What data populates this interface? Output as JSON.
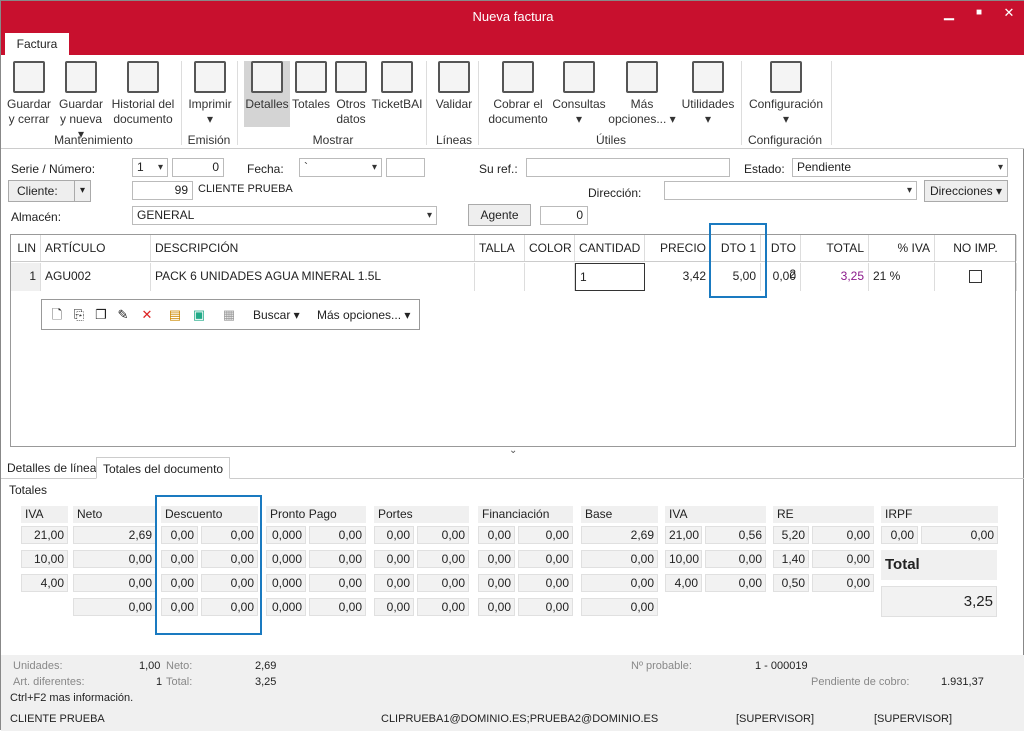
{
  "window": {
    "title": "Nueva factura",
    "minimize": "▁",
    "maximize": "■",
    "close": "✕"
  },
  "ribbon": {
    "tab": "Factura",
    "buttons": [
      {
        "id": "guardar-cerrar",
        "label": "Guardar\ny cerrar",
        "icon": "save-close-icon"
      },
      {
        "id": "guardar-nueva",
        "label": "Guardar\ny nueva ▾",
        "icon": "save-new-icon"
      },
      {
        "id": "historial",
        "label": "Historial del\ndocumento",
        "icon": "history-icon"
      },
      {
        "id": "imprimir",
        "label": "Imprimir\n▾",
        "icon": "printer-icon"
      },
      {
        "id": "detalles",
        "label": "Detalles",
        "icon": "details-icon",
        "selected": true
      },
      {
        "id": "totales",
        "label": "Totales",
        "icon": "totals-icon"
      },
      {
        "id": "otros-datos",
        "label": "Otros\ndatos",
        "icon": "other-data-icon"
      },
      {
        "id": "ticketbai",
        "label": "TicketBAI",
        "icon": "qr-icon"
      },
      {
        "id": "validar",
        "label": "Validar",
        "icon": "validate-icon"
      },
      {
        "id": "cobrar",
        "label": "Cobrar el\ndocumento",
        "icon": "money-icon"
      },
      {
        "id": "consultas",
        "label": "Consultas\n▾",
        "icon": "reports-icon"
      },
      {
        "id": "mas-opciones",
        "label": "Más\nopciones... ▾",
        "icon": "phone-icon"
      },
      {
        "id": "utilidades",
        "label": "Utilidades\n▾",
        "icon": "calculator-icon"
      },
      {
        "id": "configuracion",
        "label": "Configuración\n▾",
        "icon": "gear-icon"
      }
    ],
    "groups": [
      "Mantenimiento",
      "Emisión",
      "Mostrar",
      "Líneas",
      "Útiles",
      "Configuración"
    ]
  },
  "header": {
    "serie_label": "Serie / Número:",
    "serie": "1",
    "numero": "0",
    "fecha_label": "Fecha:",
    "fecha": "`",
    "suref_label": "Su ref.:",
    "suref": "",
    "estado_label": "Estado:",
    "estado": "Pendiente",
    "cliente_btn": "Cliente:",
    "cliente_code": "99",
    "cliente_name": "CLIENTE PRUEBA",
    "direccion_label": "Dirección:",
    "direccion": "",
    "direcciones_btn": "Direcciones ▾",
    "almacen_label": "Almacén:",
    "almacen": "GENERAL",
    "agente_btn": "Agente",
    "agente": "0"
  },
  "lines": {
    "columns": [
      "LIN",
      "ARTÍCULO",
      "DESCRIPCIÓN",
      "TALLA",
      "COLOR",
      "CANTIDAD",
      "PRECIO",
      "DTO 1",
      "DTO 2",
      "TOTAL",
      "% IVA",
      "NO IMP."
    ],
    "rows": [
      {
        "lin": "1",
        "articulo": "AGU002",
        "descripcion": "PACK 6 UNIDADES AGUA MINERAL 1.5L",
        "talla": "",
        "color": "",
        "cantidad": "1",
        "precio": "3,42",
        "dto1": "5,00",
        "dto2": "0,00",
        "total": "3,25",
        "iva": "21 %",
        "no_imp": false
      }
    ],
    "toolbar": {
      "buscar": "Buscar ▾",
      "mas": "Más opciones... ▾"
    }
  },
  "lower_tabs": [
    "Detalles de línea",
    "Totales del documento"
  ],
  "totals": {
    "title": "Totales",
    "headers": [
      "IVA",
      "Neto",
      "Descuento",
      "Pronto Pago",
      "Portes",
      "Financiación",
      "Base",
      "IVA",
      "RE",
      "IRPF"
    ],
    "rows": [
      [
        "21,00",
        "2,69",
        "0,00",
        "0,00",
        "0,000",
        "0,00",
        "0,00",
        "0,00",
        "0,00",
        "0,00",
        "2,69",
        "21,00",
        "0,56",
        "5,20",
        "0,00",
        "0,00",
        "0,00"
      ],
      [
        "10,00",
        "0,00",
        "0,00",
        "0,00",
        "0,000",
        "0,00",
        "0,00",
        "0,00",
        "0,00",
        "0,00",
        "0,00",
        "10,00",
        "0,00",
        "1,40",
        "0,00"
      ],
      [
        "4,00",
        "0,00",
        "0,00",
        "0,00",
        "0,000",
        "0,00",
        "0,00",
        "0,00",
        "0,00",
        "0,00",
        "0,00",
        "4,00",
        "0,00",
        "0,50",
        "0,00"
      ],
      [
        "",
        "0,00",
        "0,00",
        "0,00",
        "0,000",
        "0,00",
        "0,00",
        "0,00",
        "0,00",
        "0,00",
        "0,00"
      ]
    ],
    "total_label": "Total",
    "total": "3,25"
  },
  "footer": {
    "unidades_label": "Unidades:",
    "unidades": "1,00",
    "neto_label": "Neto:",
    "neto": "2,69",
    "art_label": "Art. diferentes:",
    "art": "1",
    "total_label": "Total:",
    "total": "3,25",
    "probable_label": "Nº probable:",
    "probable": "1 - 000019",
    "pendiente_label": "Pendiente de cobro:",
    "pendiente": "1.931,37",
    "hint": "Ctrl+F2 mas información.",
    "status_client": "CLIENTE PRUEBA",
    "status_email": "CLIPRUEBA1@DOMINIO.ES;PRUEBA2@DOMINIO.ES",
    "status_user1": "[SUPERVISOR]",
    "status_user2": "[SUPERVISOR]"
  },
  "colors": {
    "accent": "#c8102e",
    "highlight": "#1a7ac0",
    "total_text": "#8b1a8b"
  }
}
